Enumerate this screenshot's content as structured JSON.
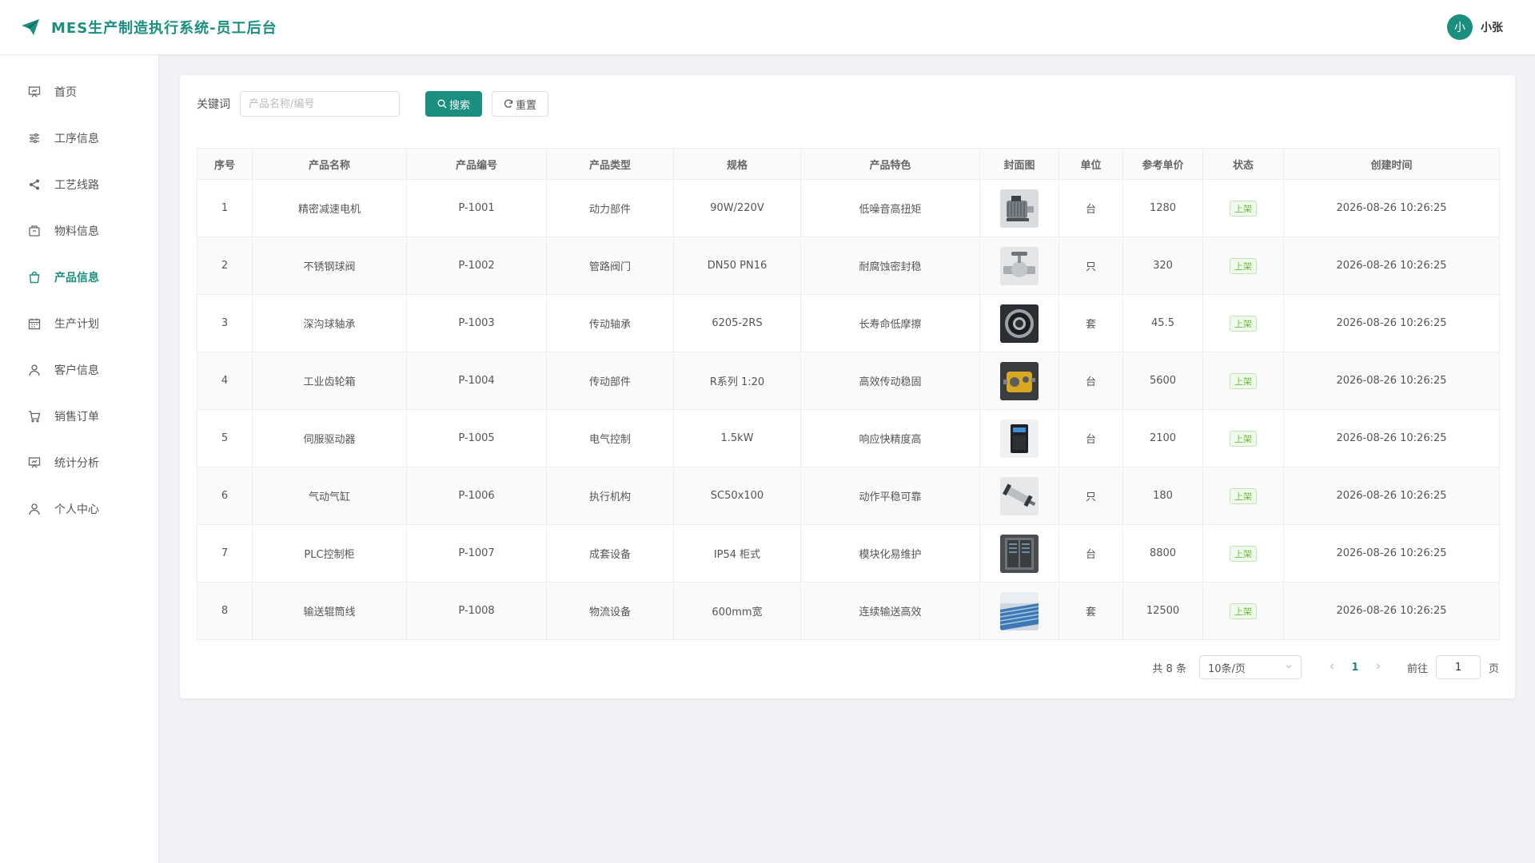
{
  "header": {
    "title": "MES生产制造执行系统-员工后台",
    "logo_icon": "paper-plane-icon",
    "user": {
      "avatar_text": "小",
      "name": "小张"
    }
  },
  "colors": {
    "accent": "#1a8f7e",
    "status_green": "#67c23a"
  },
  "sidebar": {
    "items": [
      {
        "label": "首页",
        "icon": "presentation-icon",
        "active": false
      },
      {
        "label": "工序信息",
        "icon": "sliders-icon",
        "active": false
      },
      {
        "label": "工艺线路",
        "icon": "share-icon",
        "active": false
      },
      {
        "label": "物料信息",
        "icon": "box-icon",
        "active": false
      },
      {
        "label": "产品信息",
        "icon": "shopping-bag-icon",
        "active": true
      },
      {
        "label": "生产计划",
        "icon": "calendar-icon",
        "active": false
      },
      {
        "label": "客户信息",
        "icon": "user-icon",
        "active": false
      },
      {
        "label": "销售订单",
        "icon": "cart-icon",
        "active": false
      },
      {
        "label": "统计分析",
        "icon": "chart-board-icon",
        "active": false
      },
      {
        "label": "个人中心",
        "icon": "user-icon",
        "active": false
      }
    ]
  },
  "search": {
    "label": "关键词",
    "placeholder": "产品名称/编号",
    "value": "",
    "search_button": "搜索",
    "reset_button": "重置"
  },
  "table": {
    "columns": [
      "序号",
      "产品名称",
      "产品编号",
      "产品类型",
      "规格",
      "产品特色",
      "封面图",
      "单位",
      "参考单价",
      "状态",
      "创建时间"
    ],
    "rows": [
      {
        "idx": "1",
        "name": "精密减速电机",
        "code": "P-1001",
        "type": "动力部件",
        "spec": "90W/220V",
        "feature": "低噪音高扭矩",
        "cover": "motor-thumbnail",
        "unit": "台",
        "price": "1280",
        "status": "上架",
        "created": "2026-08-26 10:26:25"
      },
      {
        "idx": "2",
        "name": "不锈钢球阀",
        "code": "P-1002",
        "type": "管路阀门",
        "spec": "DN50 PN16",
        "feature": "耐腐蚀密封稳",
        "cover": "valve-thumbnail",
        "unit": "只",
        "price": "320",
        "status": "上架",
        "created": "2026-08-26 10:26:25"
      },
      {
        "idx": "3",
        "name": "深沟球轴承",
        "code": "P-1003",
        "type": "传动轴承",
        "spec": "6205-2RS",
        "feature": "长寿命低摩擦",
        "cover": "bearing-thumbnail",
        "unit": "套",
        "price": "45.5",
        "status": "上架",
        "created": "2026-08-26 10:26:25"
      },
      {
        "idx": "4",
        "name": "工业齿轮箱",
        "code": "P-1004",
        "type": "传动部件",
        "spec": "R系列 1:20",
        "feature": "高效传动稳固",
        "cover": "gearbox-thumbnail",
        "unit": "台",
        "price": "5600",
        "status": "上架",
        "created": "2026-08-26 10:26:25"
      },
      {
        "idx": "5",
        "name": "伺服驱动器",
        "code": "P-1005",
        "type": "电气控制",
        "spec": "1.5kW",
        "feature": "响应快精度高",
        "cover": "servo-drive-thumbnail",
        "unit": "台",
        "price": "2100",
        "status": "上架",
        "created": "2026-08-26 10:26:25"
      },
      {
        "idx": "6",
        "name": "气动气缸",
        "code": "P-1006",
        "type": "执行机构",
        "spec": "SC50x100",
        "feature": "动作平稳可靠",
        "cover": "cylinder-thumbnail",
        "unit": "只",
        "price": "180",
        "status": "上架",
        "created": "2026-08-26 10:26:25"
      },
      {
        "idx": "7",
        "name": "PLC控制柜",
        "code": "P-1007",
        "type": "成套设备",
        "spec": "IP54 柜式",
        "feature": "模块化易维护",
        "cover": "cabinet-thumbnail",
        "unit": "台",
        "price": "8800",
        "status": "上架",
        "created": "2026-08-26 10:26:25"
      },
      {
        "idx": "8",
        "name": "输送辊筒线",
        "code": "P-1008",
        "type": "物流设备",
        "spec": "600mm宽",
        "feature": "连续输送高效",
        "cover": "conveyor-thumbnail",
        "unit": "套",
        "price": "12500",
        "status": "上架",
        "created": "2026-08-26 10:26:25"
      }
    ]
  },
  "pagination": {
    "total": "共 8 条",
    "page_size": "10条/页",
    "current_page": "1",
    "goto_label": "前往",
    "goto_value": "1",
    "page_suffix": "页"
  }
}
